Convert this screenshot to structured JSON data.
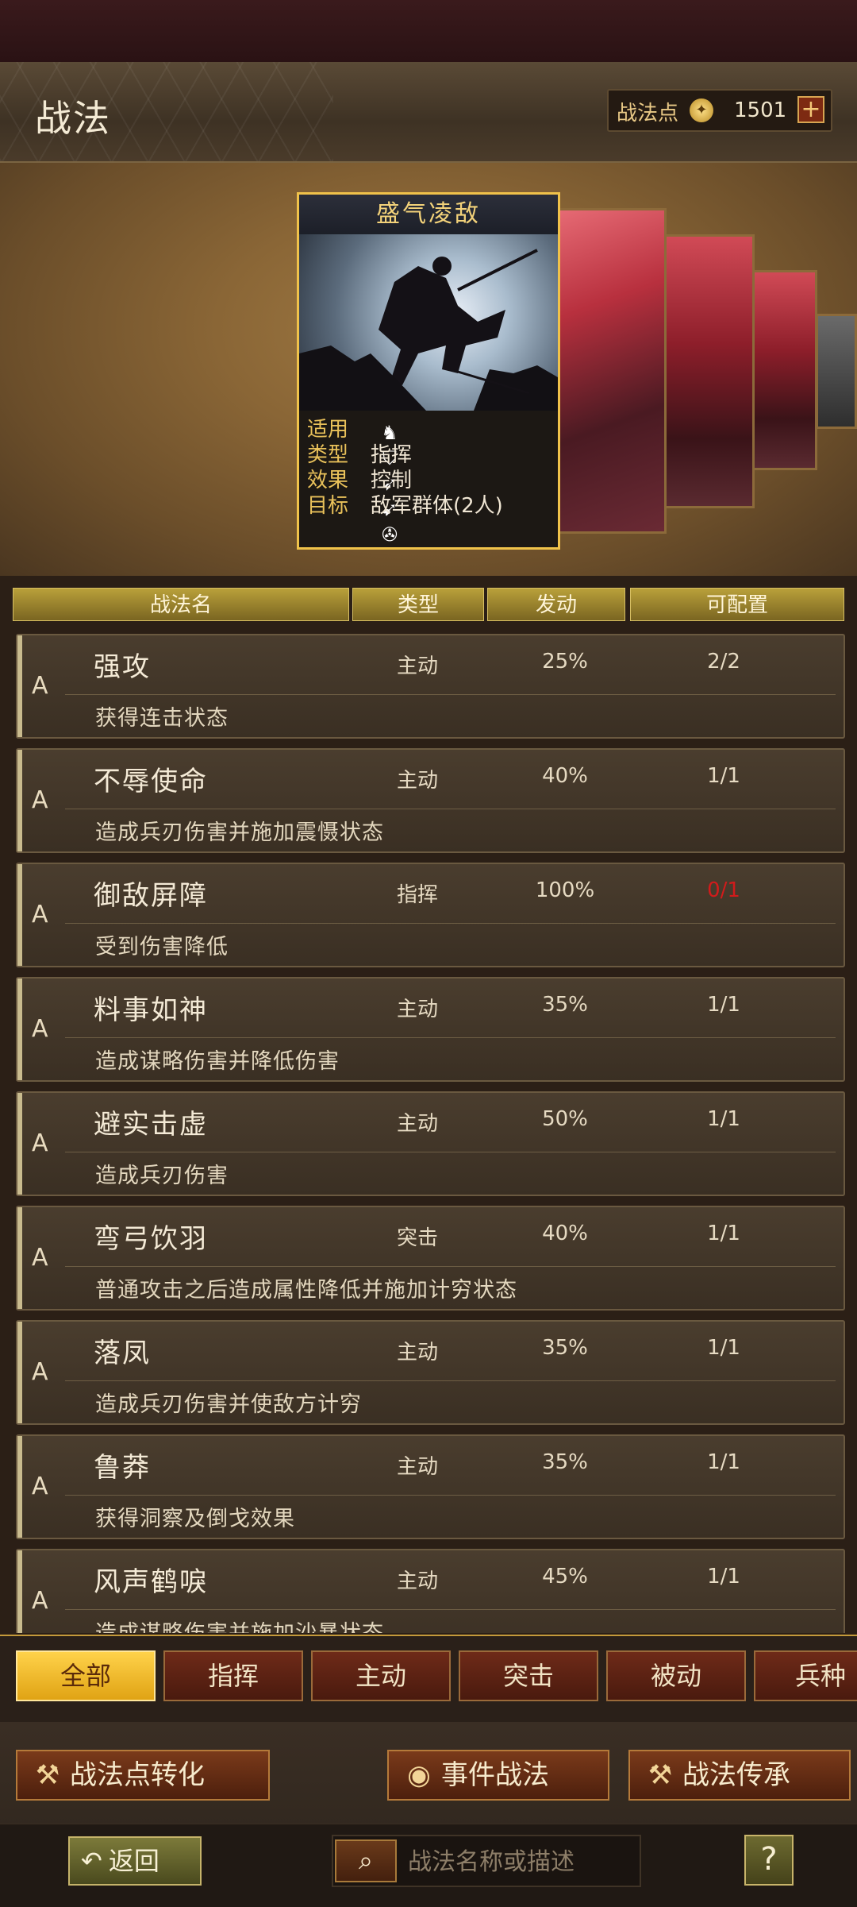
{
  "header": {
    "title": "战法",
    "points_label": "战法点",
    "points_value": "1501",
    "add_label": "+"
  },
  "featured_card": {
    "name": "盛气凌敌",
    "rows": [
      {
        "key": "适用",
        "value": ""
      },
      {
        "key": "类型",
        "value": "指挥"
      },
      {
        "key": "效果",
        "value": "控制"
      },
      {
        "key": "目标",
        "value": "敌军群体(2人)"
      }
    ],
    "troop_icons": [
      "cavalry-icon",
      "shield-icon",
      "archer-icon",
      "spear-icon",
      "chariot-icon"
    ]
  },
  "table": {
    "headers": [
      "战法名",
      "类型",
      "发动",
      "可配置"
    ]
  },
  "skills": [
    {
      "grade": "A",
      "name": "强攻",
      "type": "主动",
      "rate": "25%",
      "slots": "2/2",
      "desc": "获得连击状态"
    },
    {
      "grade": "A",
      "name": "不辱使命",
      "type": "主动",
      "rate": "40%",
      "slots": "1/1",
      "desc": "造成兵刃伤害并施加震慑状态"
    },
    {
      "grade": "A",
      "name": "御敌屏障",
      "type": "指挥",
      "rate": "100%",
      "slots": "0/1",
      "desc": "受到伤害降低"
    },
    {
      "grade": "A",
      "name": "料事如神",
      "type": "主动",
      "rate": "35%",
      "slots": "1/1",
      "desc": "造成谋略伤害并降低伤害"
    },
    {
      "grade": "A",
      "name": "避实击虚",
      "type": "主动",
      "rate": "50%",
      "slots": "1/1",
      "desc": "造成兵刃伤害"
    },
    {
      "grade": "A",
      "name": "弯弓饮羽",
      "type": "突击",
      "rate": "40%",
      "slots": "1/1",
      "desc": "普通攻击之后造成属性降低并施加计穷状态"
    },
    {
      "grade": "A",
      "name": "落凤",
      "type": "主动",
      "rate": "35%",
      "slots": "1/1",
      "desc": "造成兵刃伤害并使敌方计穷"
    },
    {
      "grade": "A",
      "name": "鲁莽",
      "type": "主动",
      "rate": "35%",
      "slots": "1/1",
      "desc": "获得洞察及倒戈效果"
    },
    {
      "grade": "A",
      "name": "风声鹤唳",
      "type": "主动",
      "rate": "45%",
      "slots": "1/1",
      "desc": "造成谋略伤害并施加沙暴状态"
    }
  ],
  "tabs": [
    "全部",
    "指挥",
    "主动",
    "突击",
    "被动",
    "兵种"
  ],
  "actions": {
    "convert": "战法点转化",
    "event": "事件战法",
    "inherit": "战法传承"
  },
  "footer": {
    "back": "返回",
    "search_placeholder": "战法名称或描述",
    "help": "?"
  },
  "colors": {
    "accent_gold": "#f0c24a",
    "slot_full_red": "#d11b1b"
  }
}
